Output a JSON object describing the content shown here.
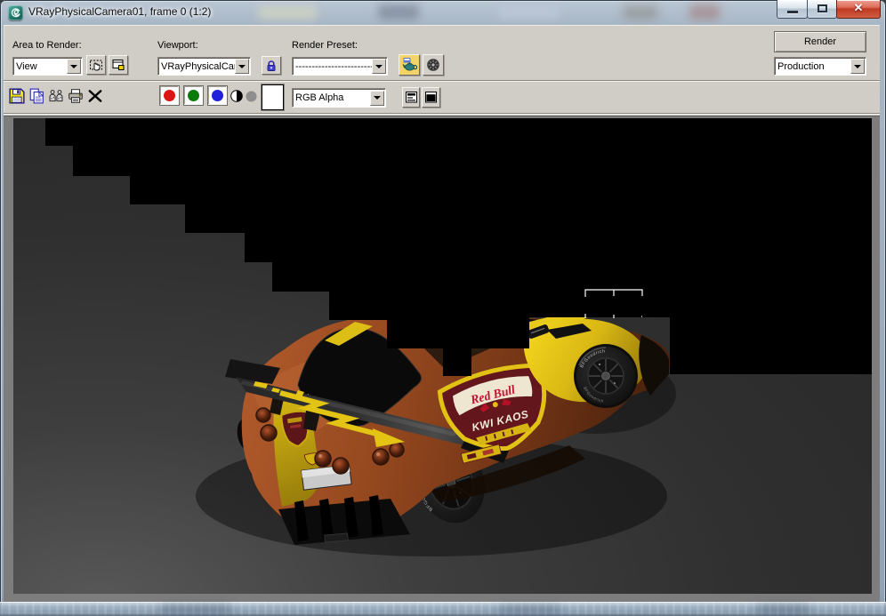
{
  "window": {
    "title": "VRayPhysicalCamera01, frame 0 (1:2)",
    "app_icon": "3ds-max-logo",
    "close_glyph": "✕"
  },
  "toolbar_top": {
    "area_to_render_label": "Area to Render:",
    "area_to_render_value": "View",
    "viewport_label": "Viewport:",
    "viewport_value": "VRayPhysicalCam",
    "render_preset_label": "Render Preset:",
    "render_preset_value": "-------------------------",
    "render_button_label": "Render",
    "render_mode_value": "Production"
  },
  "toolbar_channels": {
    "display_mode_value": "RGB Alpha"
  },
  "render_scene": {
    "tire_brand": "BFGoodrich",
    "decal_brand": "Red Bull",
    "decal_team": "KWI KAOS",
    "state": "partially rendered, bucket markers visible"
  },
  "colors": {
    "frame_glass": "#a9b8c8",
    "dialog_bg": "#d0ccc6",
    "panel_border": "#7d7d7d",
    "unrendered_black": "#000000",
    "floor_bright": "#585858",
    "floor_dark": "#262626",
    "car_body_orange": "#96491f",
    "car_accent_yellow": "#e3c414",
    "decal_red": "#c01330",
    "channel_red": "#dc1414",
    "channel_green": "#0a7a0a",
    "channel_blue": "#2020dc",
    "close_button_red": "#c03a24"
  }
}
